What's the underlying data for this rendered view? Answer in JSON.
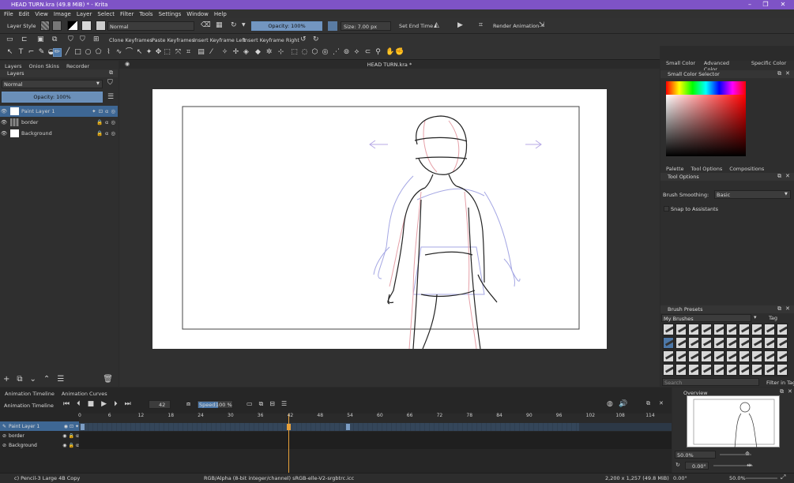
{
  "window": {
    "title": "HEAD TURN.kra (49.8 MiB)  * - Krita",
    "min": "–",
    "max": "❐",
    "close": "✕"
  },
  "menu": [
    "File",
    "Edit",
    "View",
    "Image",
    "Layer",
    "Select",
    "Filter",
    "Tools",
    "Settings",
    "Window",
    "Help"
  ],
  "toolbar": {
    "layer_style": "Layer Style",
    "blend_mode": "Normal",
    "opacity": "Opacity: 100%",
    "size": "Size: 7.00 px",
    "set_end_time": "Set End Time",
    "render_animation": "Render Animation",
    "clone_keyframes": "Clone Keyframes",
    "paste_keyframes": "Paste Keyframes",
    "insert_keyframe_left": "Insert Keyframe Left",
    "insert_keyframe_right": "Insert Keyframe Right"
  },
  "left_panel": {
    "tabs": [
      "Layers",
      "Onion Skins",
      "Recorder"
    ],
    "title": "Layers",
    "blend": "Normal",
    "opacity": "Opacity:  100%",
    "layers": [
      {
        "name": "Paint Layer 1",
        "selected": true
      },
      {
        "name": "border",
        "selected": false
      },
      {
        "name": "Background",
        "selected": false
      }
    ]
  },
  "canvas": {
    "tab": "HEAD TURN.kra *"
  },
  "right_panel": {
    "top_tabs": [
      "Small Color ...",
      "Advanced Color ...",
      "Specific Color ..."
    ],
    "color_selector_title": "Small Color Selector",
    "mid_tabs": [
      "Palette",
      "Tool Options",
      "Compositions"
    ],
    "tool_options_title": "Tool Options",
    "brush_smoothing_label": "Brush Smoothing:",
    "brush_smoothing_value": "Basic",
    "snap_label": "Snap to Assistants",
    "presets_title": "Brush Presets",
    "presets_group": "My Brushes",
    "tag_label": "Tag",
    "search_placeholder": "Search",
    "filter_label": "Filter in Tag"
  },
  "timeline": {
    "tabs": [
      "Animation Timeline",
      "Animation Curves"
    ],
    "title": "Animation Timeline",
    "current_frame": "42",
    "speed_label": "Speed:",
    "speed_value": "100 %",
    "frame_labels": [
      "0",
      "6",
      "12",
      "18",
      "24",
      "30",
      "36",
      "42",
      "48",
      "54",
      "60",
      "66",
      "72",
      "78",
      "84",
      "90",
      "96",
      "102",
      "108",
      "114"
    ],
    "layers": [
      "Paint Layer 1",
      "border",
      "Background"
    ]
  },
  "overview": {
    "title": "Overview",
    "zoom": "50.0%",
    "rotation": "0.00°"
  },
  "status": {
    "brush": "c) Pencil-3 Large 4B Copy",
    "color_space": "RGB/Alpha (8-bit integer/channel)  sRGB-elle-V2-srgbtrc.icc",
    "dimensions": "2,200 x 1,257 (49.8 MiB)",
    "rotation": "0.00°",
    "zoom": "50.0%"
  },
  "colors": {
    "titlebar": "#7e53c6",
    "accent": "#4d78a8",
    "keyframe": "#e8a13a",
    "playhead": "#e8a13a"
  }
}
